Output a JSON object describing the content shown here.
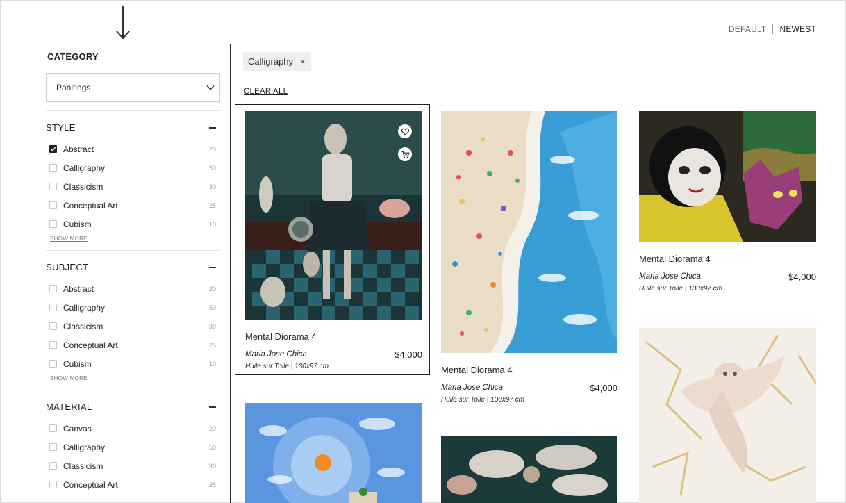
{
  "sort": {
    "options": [
      "DEFAULT",
      "NEWEST"
    ]
  },
  "sidebar": {
    "category_title": "CATEGORY",
    "category_value": "Panitings",
    "sections": [
      {
        "title": "STYLE",
        "items": [
          {
            "label": "Abstract",
            "count": "20",
            "checked": true
          },
          {
            "label": "Calligraphy",
            "count": "50",
            "checked": false
          },
          {
            "label": "Classicism",
            "count": "30",
            "checked": false
          },
          {
            "label": "Conceptual Art",
            "count": "25",
            "checked": false
          },
          {
            "label": "Cubism",
            "count": "10",
            "checked": false
          }
        ],
        "show_more": "SHOW MORE"
      },
      {
        "title": "SUBJECT",
        "items": [
          {
            "label": "Abstract",
            "count": "20",
            "checked": false
          },
          {
            "label": "Calligraphy",
            "count": "50",
            "checked": false
          },
          {
            "label": "Classicism",
            "count": "30",
            "checked": false
          },
          {
            "label": "Conceptual Art",
            "count": "25",
            "checked": false
          },
          {
            "label": "Cubism",
            "count": "10",
            "checked": false
          }
        ],
        "show_more": "SHOW MORE"
      },
      {
        "title": "MATERIAL",
        "items": [
          {
            "label": "Canvas",
            "count": "20",
            "checked": false
          },
          {
            "label": "Calligraphy",
            "count": "50",
            "checked": false
          },
          {
            "label": "Classicism",
            "count": "30",
            "checked": false
          },
          {
            "label": "Conceptual Art",
            "count": "25",
            "checked": false
          }
        ]
      }
    ]
  },
  "active_filter": {
    "label": "Calligraphy",
    "remove": "×"
  },
  "clear_all": "CLEAR ALL",
  "products": [
    {
      "title": "Mental Diorama 4",
      "artist": "Maria Jose Chica",
      "price": "$4,000",
      "medium": "Huile sur Toile | 130x97 cm"
    },
    {
      "title": "Mental Diorama 4",
      "artist": "Maria Jose Chica",
      "price": "$4,000",
      "medium": "Huile sur Toile | 130x97 cm"
    },
    {
      "title": "Mental Diorama 4",
      "artist": "Maria Jose Chica",
      "price": "$4,000",
      "medium": "Huile sur Toile | 130x97 cm"
    }
  ],
  "icons": [
    "arrow-down-icon",
    "chevron-down-icon",
    "check-icon",
    "minus-icon",
    "close-icon",
    "heart-icon",
    "cart-icon"
  ],
  "colors": {
    "text": "#1f1f1f",
    "border": "#2a2a2a",
    "chip_bg": "#efefef"
  }
}
